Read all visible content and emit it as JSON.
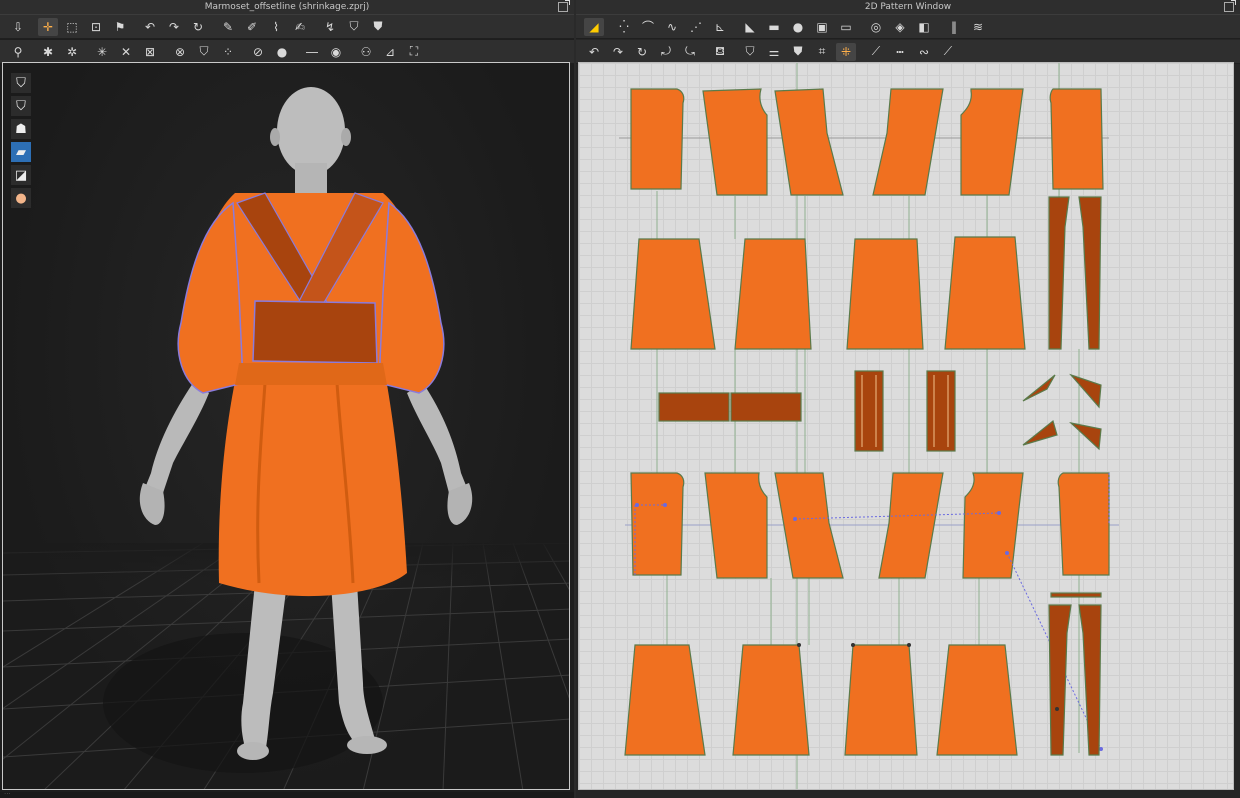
{
  "windows": {
    "left_title": "Marmoset_offsetline (shrinkage.zprj)",
    "right_title": "2D Pattern Window"
  },
  "status": {
    "text": "..."
  },
  "colors": {
    "fabric_orange": "#F07020",
    "fabric_dark": "#A8440E",
    "seam_purple": "#8a7bdc",
    "avatar_gray": "#b9b9b9",
    "grid_bg": "#dcdcdc"
  },
  "toolbar3d": {
    "row1": [
      "move-down-icon",
      "transform-plus-icon",
      "box-select-icon",
      "edit-points-icon",
      "flag-icon",
      "rotate-arrow-icon",
      "curve-arrow-icon",
      "curve-arrow-2-icon",
      "pin-icon",
      "pin-garment-icon",
      "fold-icon",
      "brush-icon",
      "pen-icon",
      "shirt-tool-icon",
      "fold-lock-icon"
    ],
    "row2": [
      "simulate-icon",
      "fold-arrange-icon",
      "tack-icon",
      "strap-icon",
      "fold-x-icon",
      "zip-icon",
      "button-icon",
      "shirt-small-icon",
      "dots-icon",
      "puff-icon",
      "circle-icon",
      "line-icon",
      "button-hole-icon",
      "avatar-measure-icon",
      "tape-icon",
      "iron-icon"
    ]
  },
  "toolbar2d": {
    "row1": [
      "select-pattern-icon",
      "select-point-icon",
      "curve-point-icon",
      "edit-curve-icon",
      "add-point-icon",
      "internal-line-icon",
      "polygon-icon",
      "rectangle-icon",
      "circle-pattern-icon",
      "image-icon",
      "frame-icon",
      "ellipse-icon",
      "dart-icon",
      "notch-icon",
      "pleat-icon",
      "fold-pattern-icon"
    ],
    "row2": [
      "segment-sewing-icon",
      "free-sewing-icon",
      "check-sewing-icon",
      "tuck-icon",
      "unfold-icon",
      "trace-icon",
      "shirt-tool-icon",
      "grading-icon",
      "avatar-pattern-icon",
      "puckering-icon",
      "sewing-active-icon",
      "seam-allowance-icon",
      "topstitch-icon",
      "edit-topstitch-icon",
      "elastic-icon"
    ]
  },
  "sidebar3d": [
    "shirt-view-icon",
    "shirt-back-icon",
    "avatar-show-icon",
    "fabric-blue-icon",
    "texture-icon",
    "avatar-skin-icon"
  ]
}
